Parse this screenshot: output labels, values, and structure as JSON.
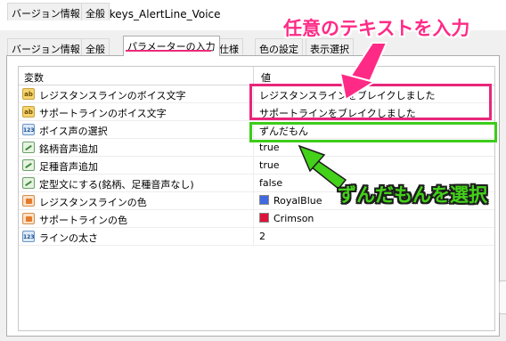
{
  "window": {
    "title": "Custom Indicator - keys_AlertLine_Voice"
  },
  "tabs": [
    {
      "label": "バージョン情報"
    },
    {
      "label": "全般"
    },
    {
      "label": "パラメーターの入力"
    },
    {
      "label": "仕様"
    },
    {
      "label": "色の設定"
    },
    {
      "label": "表示選択"
    }
  ],
  "active_tab": "パラメーターの入力",
  "grid": {
    "headers": {
      "variable": "変数",
      "value": "値"
    },
    "rows": [
      {
        "icon": "ab-string-icon",
        "name": "レジスタンスラインのボイス文字",
        "value": "レジスタンスラインをブレイクしました"
      },
      {
        "icon": "ab-string-icon",
        "name": "サポートラインのボイス文字",
        "value": "サポートラインをブレイクしました"
      },
      {
        "icon": "123-number-icon",
        "name": "ボイス声の選択",
        "value": "ずんだもん"
      },
      {
        "icon": "bool-icon",
        "name": "銘柄音声追加",
        "value": "true"
      },
      {
        "icon": "bool-icon",
        "name": "足種音声追加",
        "value": "true"
      },
      {
        "icon": "bool-icon",
        "name": "定型文にする(銘柄、足種音声なし)",
        "value": "false"
      },
      {
        "icon": "color-icon",
        "name": "レジスタンスラインの色",
        "value": "RoyalBlue",
        "swatch": "#4169e1"
      },
      {
        "icon": "color-icon",
        "name": "サポートラインの色",
        "value": "Crimson",
        "swatch": "#dc143c"
      },
      {
        "icon": "123-number-icon",
        "name": "ラインの太さ",
        "value": "2"
      }
    ]
  },
  "annotations": {
    "pink_text": "任意のテキストを入力",
    "green_text": "ずんだもんを選択",
    "pink_color": "#ff2a86",
    "green_color": "#43d11a"
  }
}
